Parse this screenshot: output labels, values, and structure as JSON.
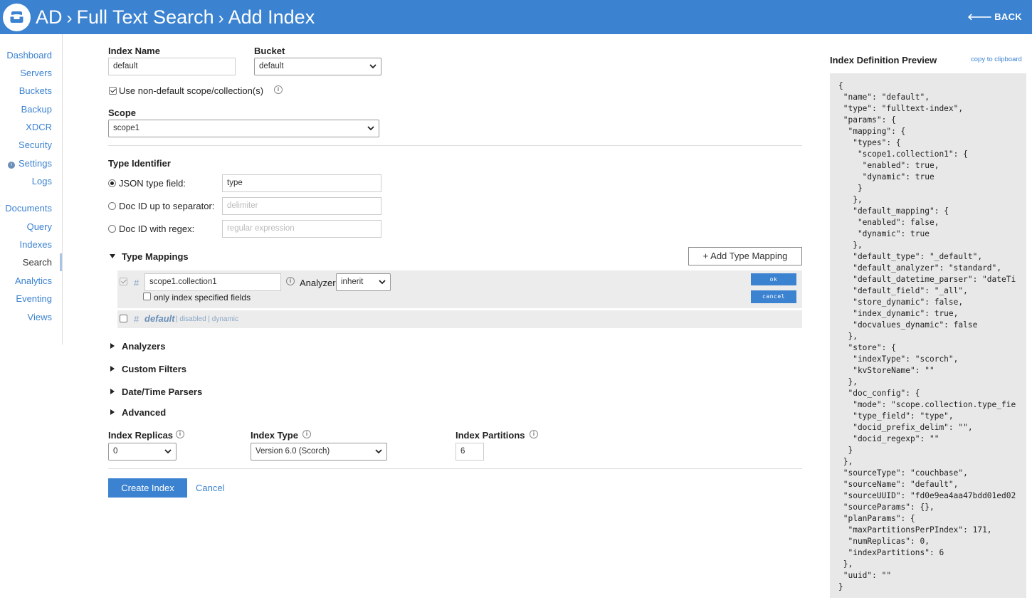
{
  "header": {
    "crumbs": [
      "AD",
      "Full Text Search",
      "Add Index"
    ],
    "back_label": "BACK"
  },
  "sidebar": {
    "items": [
      {
        "label": "Dashboard"
      },
      {
        "label": "Servers"
      },
      {
        "label": "Buckets"
      },
      {
        "label": "Backup"
      },
      {
        "label": "XDCR"
      },
      {
        "label": "Security"
      },
      {
        "label": "Settings"
      },
      {
        "label": "Logs"
      },
      {
        "label": "Documents"
      },
      {
        "label": "Query"
      },
      {
        "label": "Indexes"
      },
      {
        "label": "Search"
      },
      {
        "label": "Analytics"
      },
      {
        "label": "Eventing"
      },
      {
        "label": "Views"
      }
    ],
    "active": "Search"
  },
  "form": {
    "index_name_label": "Index Name",
    "index_name_value": "default",
    "bucket_label": "Bucket",
    "bucket_value": "default",
    "non_default_scope_label": "Use non-default scope/collection(s)",
    "non_default_scope_checked": true,
    "scope_label": "Scope",
    "scope_value": "scope1",
    "type_identifier_label": "Type Identifier",
    "json_type_label": "JSON type field:",
    "json_type_value": "type",
    "docid_sep_label": "Doc ID up to separator:",
    "docid_sep_placeholder": "delimiter",
    "docid_regex_label": "Doc ID with regex:",
    "docid_regex_placeholder": "regular expression",
    "selected_type_identifier": "json"
  },
  "type_mappings": {
    "title": "Type Mappings",
    "add_button": "+ Add Type Mapping",
    "mapping_name": "scope1.collection1",
    "analyzer_label": "Analyzer:",
    "analyzer_value": "inherit",
    "only_index_label": "only index specified fields",
    "ok_label": "ok",
    "cancel_label": "cancel",
    "default_mapping_name": "default",
    "default_mapping_meta": "| disabled | dynamic"
  },
  "sections": {
    "analyzers": "Analyzers",
    "custom_filters": "Custom Filters",
    "datetime_parsers": "Date/Time Parsers",
    "advanced": "Advanced"
  },
  "settings": {
    "replicas_label": "Index Replicas",
    "replicas_value": "0",
    "index_type_label": "Index Type",
    "index_type_value": "Version 6.0 (Scorch)",
    "partitions_label": "Index Partitions",
    "partitions_value": "6"
  },
  "actions": {
    "create_label": "Create Index",
    "cancel_label": "Cancel"
  },
  "preview": {
    "title": "Index Definition Preview",
    "copy_label": "copy to clipboard",
    "json_text": "{\n \"name\": \"default\",\n \"type\": \"fulltext-index\",\n \"params\": {\n  \"mapping\": {\n   \"types\": {\n    \"scope1.collection1\": {\n     \"enabled\": true,\n     \"dynamic\": true\n    }\n   },\n   \"default_mapping\": {\n    \"enabled\": false,\n    \"dynamic\": true\n   },\n   \"default_type\": \"_default\",\n   \"default_analyzer\": \"standard\",\n   \"default_datetime_parser\": \"dateTi\n   \"default_field\": \"_all\",\n   \"store_dynamic\": false,\n   \"index_dynamic\": true,\n   \"docvalues_dynamic\": false\n  },\n  \"store\": {\n   \"indexType\": \"scorch\",\n   \"kvStoreName\": \"\"\n  },\n  \"doc_config\": {\n   \"mode\": \"scope.collection.type_fie\n   \"type_field\": \"type\",\n   \"docid_prefix_delim\": \"\",\n   \"docid_regexp\": \"\"\n  }\n },\n \"sourceType\": \"couchbase\",\n \"sourceName\": \"default\",\n \"sourceUUID\": \"fd0e9ea4aa47bdd01ed02\n \"sourceParams\": {},\n \"planParams\": {\n  \"maxPartitionsPerPIndex\": 171,\n  \"numReplicas\": 0,\n  \"indexPartitions\": 6\n },\n \"uuid\": \"\"\n}"
  },
  "icons": {
    "logo": "couchbase-logo-icon",
    "back": "arrow-left-icon",
    "info": "info-icon",
    "dropdown": "chevron-down-icon"
  },
  "colors": {
    "header": "#3b82d0",
    "accent": "#3b82d0"
  }
}
